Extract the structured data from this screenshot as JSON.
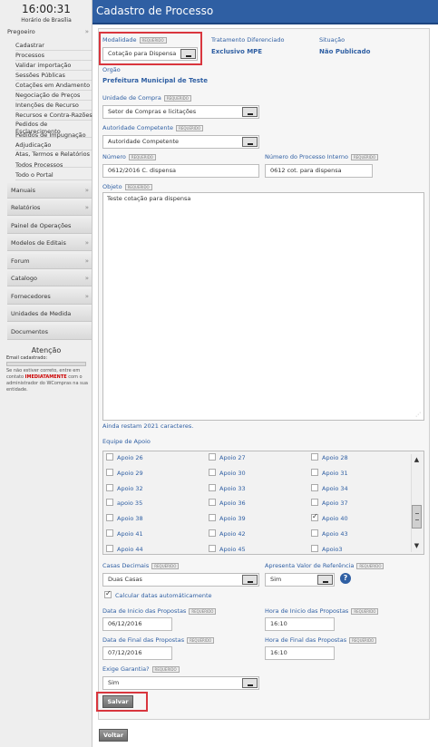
{
  "clock": {
    "time": "16:00:31",
    "subtitle": "Horário de Brasília"
  },
  "sidebar": {
    "section": "Pregoeiro",
    "items": [
      "Cadastrar",
      "Processos",
      "Validar importação",
      "Sessões Públicas",
      "Cotações em Andamento",
      "Negociação de Preços",
      "Intenções de Recurso",
      "Recursos e Contra-Razões",
      "Pedidos de Esclarecimento",
      "Pedidos de Impugnação",
      "Adjudicação",
      "Atas, Termos e Relatórios",
      "Todos Processos",
      "Todo o Portal"
    ],
    "nav": [
      "Manuais",
      "Relatórios",
      "Painel de Operações",
      "Modelos de Editais",
      "Forum",
      "Catalogo",
      "Fornecedores",
      "Unidades de Medida",
      "Documentos"
    ],
    "attention": {
      "title": "Atenção",
      "email_label": "Email cadastrado:",
      "notice_prefix": "Se não estiver correto, entre em contato",
      "notice_highlight": "IMEDIATAMENTE",
      "notice_suffix": "com o administrador do WCompras na sua entidade."
    }
  },
  "header": {
    "title": "Cadastro de Processo"
  },
  "form": {
    "required_tag": "REQUERIDO",
    "modalidade": {
      "label": "Modalidade",
      "value": "Cotação para Dispensa"
    },
    "tratamento": {
      "label": "Tratamento Diferenciado",
      "value": "Exclusivo MPE"
    },
    "situacao": {
      "label": "Situação",
      "value": "Não Publicado"
    },
    "orgao": {
      "label": "Orgão",
      "value": "Prefeitura Municipal de Teste"
    },
    "unidade": {
      "label": "Unidade de Compra",
      "value": "Setor de Compras e licitações"
    },
    "autoridade": {
      "label": "Autoridade Competente",
      "value": "Autoridade Competente"
    },
    "numero": {
      "label": "Número",
      "value": "0612/2016 C. dispensa"
    },
    "processo_interno": {
      "label": "Número do Processo Interno",
      "value": "0612 cot. para dispensa"
    },
    "objeto": {
      "label": "Objeto",
      "value": "Teste cotação para dispensa"
    },
    "chars_left": "Ainda restam 2021 caracteres.",
    "equipe": {
      "label": "Equipe de Apoio",
      "rows": [
        [
          {
            "name": "Apoio 26",
            "checked": false
          },
          {
            "name": "Apoio 27",
            "checked": false
          },
          {
            "name": "Apoio 28",
            "checked": false
          }
        ],
        [
          {
            "name": "Apoio 29",
            "checked": false
          },
          {
            "name": "Apoio 30",
            "checked": false
          },
          {
            "name": "Apoio 31",
            "checked": false
          }
        ],
        [
          {
            "name": "Apoio 32",
            "checked": false
          },
          {
            "name": "Apoio 33",
            "checked": false
          },
          {
            "name": "Apoio 34",
            "checked": false
          }
        ],
        [
          {
            "name": "apoio 35",
            "checked": false
          },
          {
            "name": "Apoio 36",
            "checked": false
          },
          {
            "name": "Apoio 37",
            "checked": false
          }
        ],
        [
          {
            "name": "Apoio 38",
            "checked": false
          },
          {
            "name": "Apoio 39",
            "checked": false
          },
          {
            "name": "Apoio 40",
            "checked": true
          }
        ],
        [
          {
            "name": "Apoio 41",
            "checked": false
          },
          {
            "name": "Apoio 42",
            "checked": false
          },
          {
            "name": "Apoio 43",
            "checked": false
          }
        ],
        [
          {
            "name": "Apoio 44",
            "checked": false
          },
          {
            "name": "Apoio 45",
            "checked": false
          },
          {
            "name": "Apoio3",
            "checked": false
          }
        ]
      ]
    },
    "casas": {
      "label": "Casas Decimais",
      "value": "Duas Casas"
    },
    "valor_ref": {
      "label": "Apresenta Valor de Referência",
      "value": "Sim",
      "help": "?"
    },
    "calcular": {
      "label": "Calcular datas automáticamente",
      "checked": true
    },
    "data_inicio": {
      "label": "Data de Inicio das Propostas",
      "value": "06/12/2016"
    },
    "hora_inicio": {
      "label": "Hora de Inicio das Propostas",
      "value": "16:10"
    },
    "data_final": {
      "label": "Data de Final das Propostas",
      "value": "07/12/2016"
    },
    "hora_final": {
      "label": "Hora de Final das Propostas",
      "value": "16:10"
    },
    "garantia": {
      "label": "Exige Garantia?",
      "value": "Sim"
    },
    "save_label": "Salvar",
    "back_label": "Voltar"
  },
  "colors": {
    "header_bg": "#2f5fa3",
    "label_blue": "#2f5fa3",
    "highlight_red": "#d9363e"
  }
}
